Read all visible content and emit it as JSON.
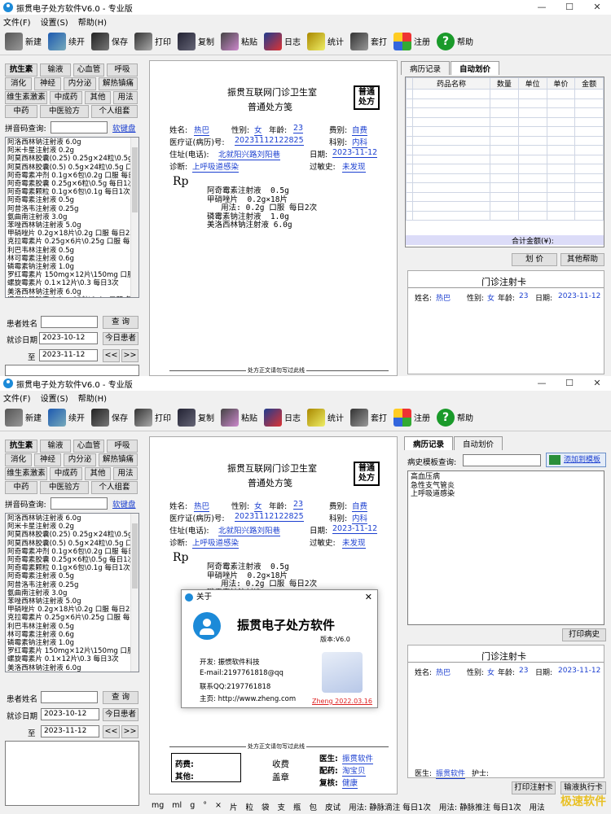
{
  "window_title": "振贯电子处方软件V6.0 - 专业版",
  "window_controls": [
    "—",
    "☐",
    "✕"
  ],
  "menu": [
    "文件(F)",
    "设置(S)",
    "帮助(H)"
  ],
  "toolbar": [
    {
      "label": "新建",
      "icon": "new-file-icon"
    },
    {
      "label": "续开",
      "icon": "continue-icon"
    },
    {
      "label": "保存",
      "icon": "save-icon"
    },
    {
      "label": "打印",
      "icon": "print-icon"
    },
    {
      "label": "复制",
      "icon": "copy-icon"
    },
    {
      "label": "粘贴",
      "icon": "paste-icon"
    },
    {
      "label": "日志",
      "icon": "log-icon"
    },
    {
      "label": "统计",
      "icon": "statistics-icon"
    },
    {
      "label": "套打",
      "icon": "template-print-icon"
    },
    {
      "label": "注册",
      "icon": "register-icon"
    },
    {
      "label": "帮助",
      "icon": "help-icon"
    }
  ],
  "help_glyph": "?",
  "categories": [
    "抗生素",
    "输液",
    "心血管",
    "呼吸",
    "消化",
    "神经",
    "内分泌",
    "解热镇痛",
    "维生素激素",
    "中成药",
    "其他",
    "用法",
    "中药",
    "中医验方",
    "个人组套"
  ],
  "pinyin_label": "拼音码查询:",
  "soft_keyboard": "软键盘",
  "drugs": [
    "阿洛西林钠注射液 6.0g",
    "阿米卡星注射液 0.2g",
    "阿莫西林胶囊(0.25) 0.25g×24粒\\0.5g 口",
    "阿莫西林胶囊(0.5) 0.5g×24粒\\0.5g 口服",
    "阿奇霉素冲剂 0.1g×6包\\0.2g 口服 每日",
    "阿奇霉素胶囊 0.25g×6粒\\0.5g 每日1次",
    "阿奇霉素颗粒 0.1g×6包\\0.1g 每日1次",
    "阿奇霉素注射液 0.5g",
    "阿昔洛韦注射液 0.25g",
    "氨曲南注射液 3.0g",
    "苯唑西林钠注射液 5.0g",
    "甲硝唑片 0.2g×18片\\0.2g 口服 每日2次",
    "克拉霉素片 0.25g×6片\\0.25g 口服 每日",
    "利巴韦林注射液 0.5g",
    "林可霉素注射液 0.6g",
    "磷霉素钠注射液 1.0g",
    "罗红霉素片 150mg×12片\\150mg 口服 每",
    "螺旋霉素片 0.1×12片\\0.3 每日3次",
    "美洛西林钠注射液 6.0g",
    "诺氟沙星胶囊 0.1g×12粒\\0.4g 口服 每"
  ],
  "patient_search": {
    "name_label": "患者姓名",
    "query_button": "查 询",
    "date_label": "就诊日期",
    "date_from_win1": "2023-10-12",
    "date_from_win2": "2023-10-12",
    "to_label": "至",
    "date_to": "2023-11-12",
    "today_button": "今日患者",
    "prev": "<<",
    "next": ">>"
  },
  "prescription": {
    "clinic": "振贯互联网门诊卫生室",
    "title": "普通处方笺",
    "type_badge": "普通处方",
    "name_label": "姓名:",
    "name": "热巴",
    "gender_label": "性别:",
    "gender": "女",
    "age_label": "年龄:",
    "age": "23",
    "fee_label": "费别:",
    "fee": "自费",
    "record_label": "医疗证(病历)号:",
    "record": "20231112122825",
    "dept_label": "科别:",
    "dept": "内科",
    "address_label": "住址(电话):",
    "address": "北就阳兴路刘阳巷",
    "date_label": "日期:",
    "date": "2023-11-12",
    "diagnosis_label": "诊断:",
    "diagnosis": "上呼吸道感染",
    "allergy_label": "过敏史:",
    "allergy": "未发现",
    "rp": "Rp",
    "items": [
      "阿奇霉素注射液  0.5g",
      "甲硝唑片  0.2g×18片",
      "   用法: 0.2g 口服 每日2次",
      "",
      "磷霉素钠注射液  1.0g",
      "美洛西林钠注射液 6.0g"
    ],
    "blank_note": "处方正文请勿写过此线",
    "fee_box": {
      "drug_fee": "药费:",
      "other": "其他:"
    },
    "charge": "收费",
    "seal": "盖章",
    "doctor_label": "医生:",
    "doctor": "振贯软件",
    "dispense_label": "配药:",
    "dispense": "淘宝贝",
    "check_label": "复核:",
    "check": "健康"
  },
  "right_panel": {
    "tab_history": "病历记录",
    "tab_pricing": "自动划价",
    "grid_headers": [
      "",
      "药品名称",
      "数量",
      "单位",
      "单价",
      "金额"
    ],
    "total_label": "合计金额(¥):",
    "pricing_button": "划 价",
    "other_help_button": "其他帮助",
    "history_query_label": "病史模板查询:",
    "add_template": "添加到模板",
    "history_items": [
      "高血压病",
      "急性支气管炎",
      "上呼吸道感染"
    ],
    "print_history": "打印病史",
    "injection_title": "门诊注射卡",
    "inj_name_label": "姓名:",
    "inj_name": "热巴",
    "inj_gender_label": "性别:",
    "inj_gender": "女",
    "inj_age_label": "年龄:",
    "inj_age": "23",
    "inj_date_label": "日期:",
    "inj_date": "2023-11-12",
    "inj_doctor_label": "医生:",
    "inj_doctor": "振贯软件",
    "inj_nurse_label": "护士:",
    "print_injection": "打印注射卡",
    "infusion_card": "输液执行卡"
  },
  "about_dialog": {
    "title": "关于",
    "app_name": "振贯电子处方软件",
    "version": "版本:V6.0",
    "developer": "开发: 振惯软件科技",
    "email": "E-mail:2197761818@qq",
    "qq": "联系QQ:2197761818",
    "homepage": "主页: http://www.zheng.com",
    "date_stamp": "Zheng 2022.03.16"
  },
  "statusbar": [
    "mg",
    "ml",
    "g",
    "°",
    "×",
    "片",
    "粒",
    "袋",
    "支",
    "瓶",
    "包",
    "皮试",
    "用法: 静脉滴注 每日1次",
    "用法: 静脉推注 每日1次",
    "用法"
  ],
  "watermark": "极速软件",
  "colors": {
    "link_blue": "#1b3fd0",
    "selected_tab": "#ffffff",
    "help_green": "#1a9a2a",
    "accent_blue": "#1c8ad8"
  }
}
